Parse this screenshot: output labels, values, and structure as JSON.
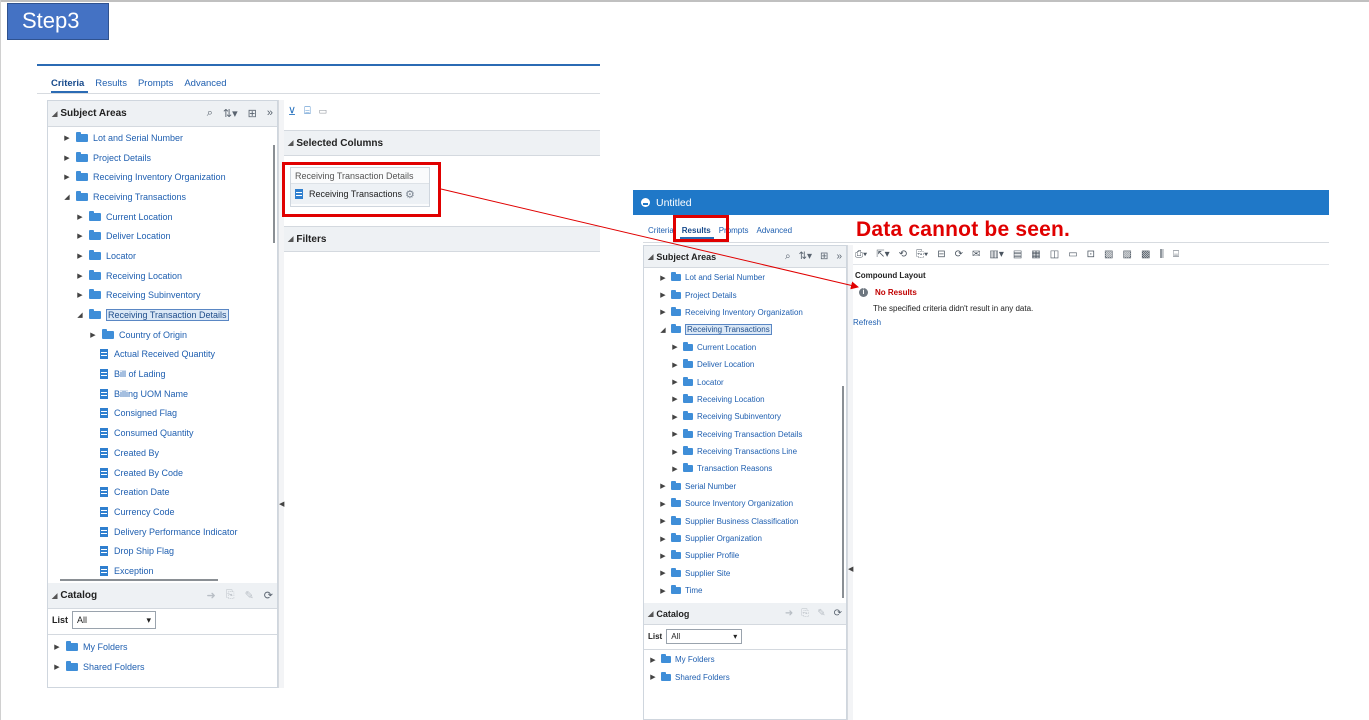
{
  "step_label": "Step3",
  "annotation": "Data cannot be seen.",
  "left": {
    "tabs": [
      "Criteria",
      "Results",
      "Prompts",
      "Advanced"
    ],
    "subject_areas": {
      "title": "Subject Areas",
      "items": [
        {
          "label": "Lot and Serial Number",
          "level": 0,
          "type": "folder",
          "expanded": false
        },
        {
          "label": "Project Details",
          "level": 0,
          "type": "folder",
          "expanded": false
        },
        {
          "label": "Receiving Inventory Organization",
          "level": 0,
          "type": "folder",
          "expanded": false
        },
        {
          "label": "Receiving Transactions",
          "level": 0,
          "type": "folder",
          "expanded": true
        },
        {
          "label": "Current Location",
          "level": 1,
          "type": "folder",
          "expanded": false
        },
        {
          "label": "Deliver Location",
          "level": 1,
          "type": "folder",
          "expanded": false
        },
        {
          "label": "Locator",
          "level": 1,
          "type": "folder",
          "expanded": false
        },
        {
          "label": "Receiving Location",
          "level": 1,
          "type": "folder",
          "expanded": false
        },
        {
          "label": "Receiving Subinventory",
          "level": 1,
          "type": "folder",
          "expanded": false
        },
        {
          "label": "Receiving Transaction Details",
          "level": 1,
          "type": "folder",
          "expanded": true,
          "selected": true
        },
        {
          "label": "Country of Origin",
          "level": 2,
          "type": "folder",
          "expanded": false
        },
        {
          "label": "Actual Received Quantity",
          "level": 2,
          "type": "column"
        },
        {
          "label": "Bill of Lading",
          "level": 2,
          "type": "column"
        },
        {
          "label": "Billing UOM Name",
          "level": 2,
          "type": "column"
        },
        {
          "label": "Consigned Flag",
          "level": 2,
          "type": "column"
        },
        {
          "label": "Consumed Quantity",
          "level": 2,
          "type": "column"
        },
        {
          "label": "Created By",
          "level": 2,
          "type": "column"
        },
        {
          "label": "Created By Code",
          "level": 2,
          "type": "column"
        },
        {
          "label": "Creation Date",
          "level": 2,
          "type": "column"
        },
        {
          "label": "Currency Code",
          "level": 2,
          "type": "column"
        },
        {
          "label": "Delivery Performance Indicator",
          "level": 2,
          "type": "column"
        },
        {
          "label": "Drop Ship Flag",
          "level": 2,
          "type": "column"
        },
        {
          "label": "Exception",
          "level": 2,
          "type": "column"
        }
      ]
    },
    "catalog": {
      "title": "Catalog",
      "list_label": "List",
      "list_value": "All",
      "items": [
        "My Folders",
        "Shared Folders"
      ]
    },
    "selected_columns": {
      "title": "Selected Columns",
      "group": "Receiving Transaction Details",
      "column": "Receiving Transactions"
    },
    "filters_title": "Filters"
  },
  "right": {
    "window_title": "Untitled",
    "tabs": [
      "Criteria",
      "Results",
      "Prompts",
      "Advanced"
    ],
    "subject_areas": {
      "title": "Subject Areas",
      "items": [
        {
          "label": "Lot and Serial Number",
          "level": 0,
          "expanded": false
        },
        {
          "label": "Project Details",
          "level": 0,
          "expanded": false
        },
        {
          "label": "Receiving Inventory Organization",
          "level": 0,
          "expanded": false
        },
        {
          "label": "Receiving Transactions",
          "level": 0,
          "expanded": true,
          "selected": true
        },
        {
          "label": "Current Location",
          "level": 1,
          "expanded": false
        },
        {
          "label": "Deliver Location",
          "level": 1,
          "expanded": false
        },
        {
          "label": "Locator",
          "level": 1,
          "expanded": false
        },
        {
          "label": "Receiving Location",
          "level": 1,
          "expanded": false
        },
        {
          "label": "Receiving Subinventory",
          "level": 1,
          "expanded": false
        },
        {
          "label": "Receiving Transaction Details",
          "level": 1,
          "expanded": false
        },
        {
          "label": "Receiving Transactions Line",
          "level": 1,
          "expanded": false
        },
        {
          "label": "Transaction Reasons",
          "level": 1,
          "expanded": false
        },
        {
          "label": "Serial Number",
          "level": 0,
          "expanded": false
        },
        {
          "label": "Source Inventory Organization",
          "level": 0,
          "expanded": false
        },
        {
          "label": "Supplier Business Classification",
          "level": 0,
          "expanded": false
        },
        {
          "label": "Supplier Organization",
          "level": 0,
          "expanded": false
        },
        {
          "label": "Supplier Profile",
          "level": 0,
          "expanded": false
        },
        {
          "label": "Supplier Site",
          "level": 0,
          "expanded": false
        },
        {
          "label": "Time",
          "level": 0,
          "expanded": false
        }
      ]
    },
    "catalog": {
      "title": "Catalog",
      "list_label": "List",
      "list_value": "All",
      "items": [
        "My Folders",
        "Shared Folders"
      ]
    },
    "compound_layout": "Compound Layout",
    "no_results_title": "No Results",
    "no_results_message": "The specified criteria didn't result in any data.",
    "refresh_label": "Refresh"
  },
  "colors": {
    "accent": "#2b6bb4",
    "title_bar": "#1f78c8",
    "annotation_red": "#e00000",
    "step_label_bg": "#4472c4"
  }
}
